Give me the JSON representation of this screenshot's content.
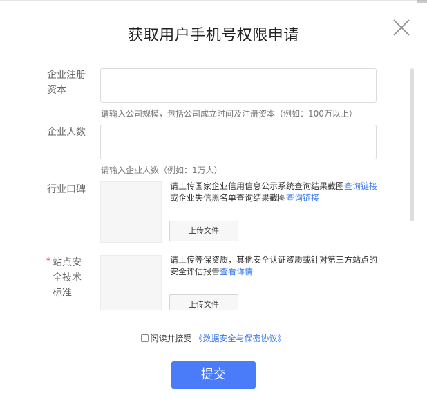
{
  "dialog": {
    "title": "获取用户手机号权限申请",
    "close_icon": "close-x-icon"
  },
  "form": {
    "registered_capital": {
      "label": "企业注册资本",
      "value": "",
      "hint": "请输入公司规模，包括公司成立时间及注册资本（例如：100万以上）"
    },
    "employee_count": {
      "label": "企业人数",
      "value": "",
      "hint": "请输入企业人数（例如：1万人）"
    },
    "industry_reputation": {
      "label": "行业口碑",
      "desc_part1": "请上传国家企业信用信息公示系统查询结果截图",
      "link1": "查询链接",
      "desc_part2": "或企业失信黑名单查询结果截图",
      "link2": "查询链接",
      "upload_label": "上传文件"
    },
    "site_security": {
      "required_mark": "*",
      "label": "站点安全技术标准",
      "desc": "请上传等保资质，其他安全认证资质或针对第三方站点的安全评估报告",
      "link": "查看详情",
      "upload_label": "上传文件"
    }
  },
  "agreement": {
    "checked": false,
    "text": "阅读并接受",
    "link": "《数据安全与保密协议》"
  },
  "submit_label": "提交",
  "colors": {
    "primary": "#4a7cfa",
    "link": "#3a7bf0",
    "required": "#e4393c"
  }
}
